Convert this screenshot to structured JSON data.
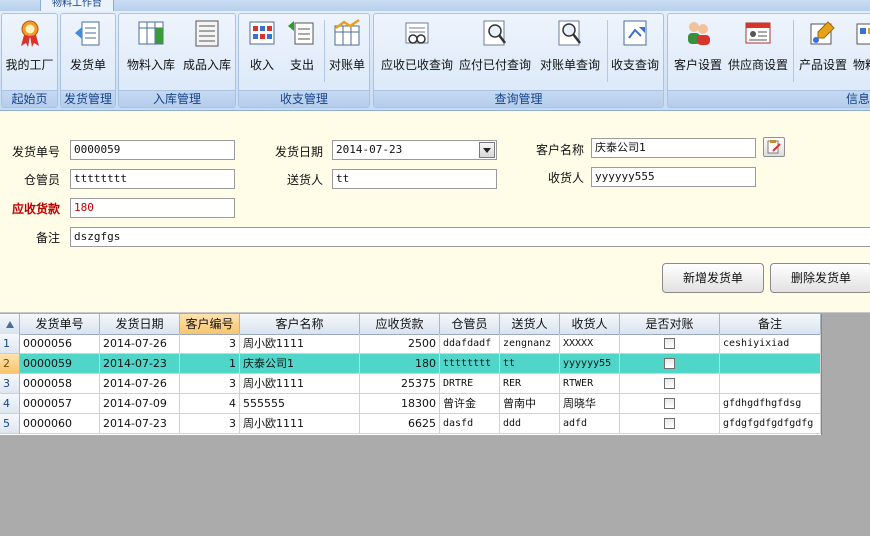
{
  "app_tab": "物料工作台",
  "ribbon": {
    "groups": [
      {
        "label": "起始页",
        "buttons": [
          {
            "label": "我的工厂",
            "icon": "award-ribbon-icon"
          }
        ]
      },
      {
        "label": "发货管理",
        "buttons": [
          {
            "label": "发货单",
            "icon": "delivery-list-icon"
          }
        ]
      },
      {
        "label": "入库管理",
        "buttons": [
          {
            "label": "物料入库",
            "icon": "material-inbound-icon"
          },
          {
            "label": "成品入库",
            "icon": "product-inbound-icon"
          }
        ]
      },
      {
        "label": "收支管理",
        "buttons": [
          {
            "label": "收入",
            "icon": "income-grid-icon"
          },
          {
            "label": "支出",
            "icon": "expense-arrows-icon"
          },
          {
            "label": "对账单",
            "icon": "reconcile-chart-icon"
          }
        ]
      },
      {
        "label": "查询管理",
        "buttons": [
          {
            "label": "应收已收查询",
            "icon": "receivable-search-icon"
          },
          {
            "label": "应付已付查询",
            "icon": "payable-search-icon"
          },
          {
            "label": "对账单查询",
            "icon": "statement-search-icon"
          },
          {
            "label": "收支查询",
            "icon": "ledger-query-icon"
          }
        ]
      },
      {
        "label": "信息",
        "buttons": [
          {
            "label": "客户设置",
            "icon": "customers-icon"
          },
          {
            "label": "供应商设置",
            "icon": "supplier-card-icon"
          },
          {
            "label": "产品设置",
            "icon": "product-settings-icon"
          },
          {
            "label": "物料",
            "icon": "material-settings-icon"
          }
        ]
      }
    ]
  },
  "form": {
    "order_no_label": "发货单号",
    "order_no": "0000059",
    "ship_date_label": "发货日期",
    "ship_date": "2014-07-23",
    "customer_label": "客户名称",
    "customer": "庆泰公司1",
    "keeper_label": "仓管员",
    "keeper": "tttttttt",
    "sender_label": "送货人",
    "sender": "tt",
    "receiver_label": "收货人",
    "receiver": "yyyyyy555",
    "amount_label": "应收货款",
    "amount": "180",
    "remark_label": "备注",
    "remark": "dszgfgs",
    "add_button": "新增发货单",
    "delete_button": "删除发货单"
  },
  "grid": {
    "columns": [
      "发货单号",
      "发货日期",
      "客户编号",
      "客户名称",
      "应收货款",
      "仓管员",
      "送货人",
      "收货人",
      "是否对账",
      "备注"
    ],
    "sorted_column": "客户编号",
    "rows": [
      {
        "no": "1",
        "order": "0000056",
        "date": "2014-07-26",
        "cust_id": "3",
        "cust": "周小欧1111",
        "amount": "2500",
        "keeper": "ddafdadf",
        "sender": "zengnanz",
        "receiver": "XXXXX",
        "checked": false,
        "remark": "ceshiyixiad"
      },
      {
        "no": "2",
        "order": "0000059",
        "date": "2014-07-23",
        "cust_id": "1",
        "cust": "庆泰公司1",
        "amount": "180",
        "keeper": "tttttttt",
        "sender": "tt",
        "receiver": "yyyyyy55",
        "checked": false,
        "remark": ""
      },
      {
        "no": "3",
        "order": "0000058",
        "date": "2014-07-26",
        "cust_id": "3",
        "cust": "周小欧1111",
        "amount": "25375",
        "keeper": "DRTRE",
        "sender": "RER",
        "receiver": "RTWER",
        "checked": false,
        "remark": ""
      },
      {
        "no": "4",
        "order": "0000057",
        "date": "2014-07-09",
        "cust_id": "4",
        "cust": "555555",
        "amount": "18300",
        "keeper": "曾许金",
        "sender": "曾南中",
        "receiver": "周晓华",
        "checked": false,
        "remark": "gfdhgdfhgfdsg"
      },
      {
        "no": "5",
        "order": "0000060",
        "date": "2014-07-23",
        "cust_id": "3",
        "cust": "周小欧1111",
        "amount": "6625",
        "keeper": "dasfd",
        "sender": "ddd",
        "receiver": "adfd",
        "checked": false,
        "remark": "gfdgfgdfgdfgdfg"
      }
    ],
    "selected_row": "2"
  },
  "colors": {
    "selected_row": "#4fd6c9",
    "form_bg": "#fffde8",
    "required_label": "#c00000"
  }
}
